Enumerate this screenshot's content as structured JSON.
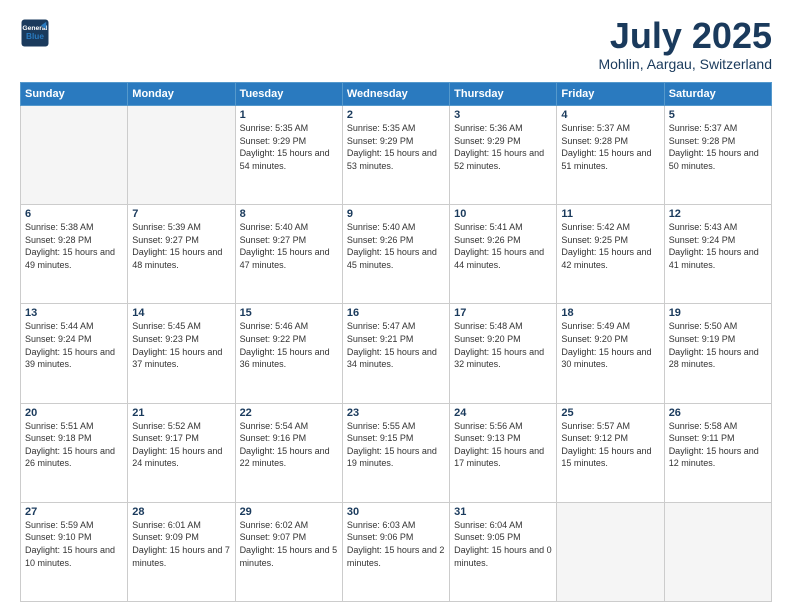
{
  "header": {
    "logo_line1": "General",
    "logo_line2": "Blue",
    "month_title": "July 2025",
    "location": "Mohlin, Aargau, Switzerland"
  },
  "weekdays": [
    "Sunday",
    "Monday",
    "Tuesday",
    "Wednesday",
    "Thursday",
    "Friday",
    "Saturday"
  ],
  "weeks": [
    [
      {
        "day": "",
        "empty": true
      },
      {
        "day": "",
        "empty": true
      },
      {
        "day": "1",
        "sunrise": "5:35 AM",
        "sunset": "9:29 PM",
        "daylight": "15 hours and 54 minutes."
      },
      {
        "day": "2",
        "sunrise": "5:35 AM",
        "sunset": "9:29 PM",
        "daylight": "15 hours and 53 minutes."
      },
      {
        "day": "3",
        "sunrise": "5:36 AM",
        "sunset": "9:29 PM",
        "daylight": "15 hours and 52 minutes."
      },
      {
        "day": "4",
        "sunrise": "5:37 AM",
        "sunset": "9:28 PM",
        "daylight": "15 hours and 51 minutes."
      },
      {
        "day": "5",
        "sunrise": "5:37 AM",
        "sunset": "9:28 PM",
        "daylight": "15 hours and 50 minutes."
      }
    ],
    [
      {
        "day": "6",
        "sunrise": "5:38 AM",
        "sunset": "9:28 PM",
        "daylight": "15 hours and 49 minutes."
      },
      {
        "day": "7",
        "sunrise": "5:39 AM",
        "sunset": "9:27 PM",
        "daylight": "15 hours and 48 minutes."
      },
      {
        "day": "8",
        "sunrise": "5:40 AM",
        "sunset": "9:27 PM",
        "daylight": "15 hours and 47 minutes."
      },
      {
        "day": "9",
        "sunrise": "5:40 AM",
        "sunset": "9:26 PM",
        "daylight": "15 hours and 45 minutes."
      },
      {
        "day": "10",
        "sunrise": "5:41 AM",
        "sunset": "9:26 PM",
        "daylight": "15 hours and 44 minutes."
      },
      {
        "day": "11",
        "sunrise": "5:42 AM",
        "sunset": "9:25 PM",
        "daylight": "15 hours and 42 minutes."
      },
      {
        "day": "12",
        "sunrise": "5:43 AM",
        "sunset": "9:24 PM",
        "daylight": "15 hours and 41 minutes."
      }
    ],
    [
      {
        "day": "13",
        "sunrise": "5:44 AM",
        "sunset": "9:24 PM",
        "daylight": "15 hours and 39 minutes."
      },
      {
        "day": "14",
        "sunrise": "5:45 AM",
        "sunset": "9:23 PM",
        "daylight": "15 hours and 37 minutes."
      },
      {
        "day": "15",
        "sunrise": "5:46 AM",
        "sunset": "9:22 PM",
        "daylight": "15 hours and 36 minutes."
      },
      {
        "day": "16",
        "sunrise": "5:47 AM",
        "sunset": "9:21 PM",
        "daylight": "15 hours and 34 minutes."
      },
      {
        "day": "17",
        "sunrise": "5:48 AM",
        "sunset": "9:20 PM",
        "daylight": "15 hours and 32 minutes."
      },
      {
        "day": "18",
        "sunrise": "5:49 AM",
        "sunset": "9:20 PM",
        "daylight": "15 hours and 30 minutes."
      },
      {
        "day": "19",
        "sunrise": "5:50 AM",
        "sunset": "9:19 PM",
        "daylight": "15 hours and 28 minutes."
      }
    ],
    [
      {
        "day": "20",
        "sunrise": "5:51 AM",
        "sunset": "9:18 PM",
        "daylight": "15 hours and 26 minutes."
      },
      {
        "day": "21",
        "sunrise": "5:52 AM",
        "sunset": "9:17 PM",
        "daylight": "15 hours and 24 minutes."
      },
      {
        "day": "22",
        "sunrise": "5:54 AM",
        "sunset": "9:16 PM",
        "daylight": "15 hours and 22 minutes."
      },
      {
        "day": "23",
        "sunrise": "5:55 AM",
        "sunset": "9:15 PM",
        "daylight": "15 hours and 19 minutes."
      },
      {
        "day": "24",
        "sunrise": "5:56 AM",
        "sunset": "9:13 PM",
        "daylight": "15 hours and 17 minutes."
      },
      {
        "day": "25",
        "sunrise": "5:57 AM",
        "sunset": "9:12 PM",
        "daylight": "15 hours and 15 minutes."
      },
      {
        "day": "26",
        "sunrise": "5:58 AM",
        "sunset": "9:11 PM",
        "daylight": "15 hours and 12 minutes."
      }
    ],
    [
      {
        "day": "27",
        "sunrise": "5:59 AM",
        "sunset": "9:10 PM",
        "daylight": "15 hours and 10 minutes."
      },
      {
        "day": "28",
        "sunrise": "6:01 AM",
        "sunset": "9:09 PM",
        "daylight": "15 hours and 7 minutes."
      },
      {
        "day": "29",
        "sunrise": "6:02 AM",
        "sunset": "9:07 PM",
        "daylight": "15 hours and 5 minutes."
      },
      {
        "day": "30",
        "sunrise": "6:03 AM",
        "sunset": "9:06 PM",
        "daylight": "15 hours and 2 minutes."
      },
      {
        "day": "31",
        "sunrise": "6:04 AM",
        "sunset": "9:05 PM",
        "daylight": "15 hours and 0 minutes."
      },
      {
        "day": "",
        "empty": true
      },
      {
        "day": "",
        "empty": true
      }
    ]
  ]
}
